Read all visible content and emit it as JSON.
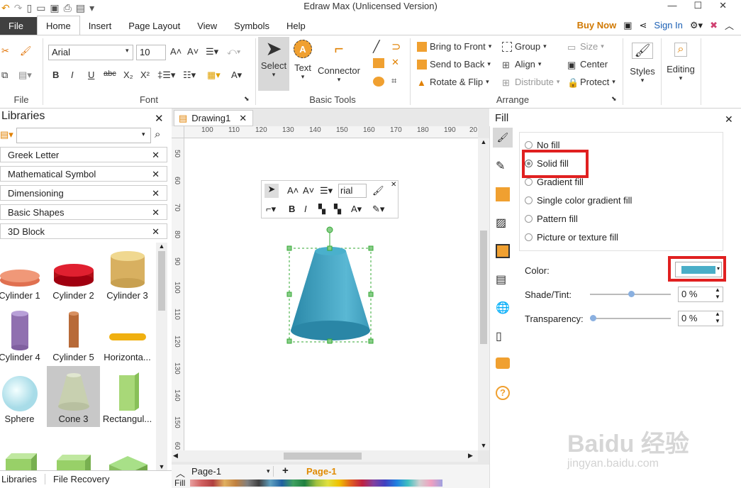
{
  "app": {
    "title": "Edraw Max (Unlicensed Version)"
  },
  "window": {
    "minimize": "—",
    "maximize": "☐",
    "close": "✕"
  },
  "menu": {
    "file": "File",
    "tabs": [
      "Home",
      "Insert",
      "Page Layout",
      "View",
      "Symbols",
      "Help"
    ],
    "buy_now": "Buy Now",
    "sign_in": "Sign In"
  },
  "ribbon": {
    "file_group": {
      "label": "File"
    },
    "font_group": {
      "label": "Font",
      "font_name": "Arial",
      "font_size": "10"
    },
    "basic_tools": {
      "label": "Basic Tools",
      "select": "Select",
      "text": "Text",
      "connector": "Connector"
    },
    "arrange": {
      "label": "Arrange",
      "bring_to_front": "Bring to Front",
      "send_to_back": "Send to Back",
      "rotate_flip": "Rotate & Flip",
      "group": "Group",
      "align": "Align",
      "distribute": "Distribute",
      "size": "Size",
      "center": "Center",
      "protect": "Protect"
    },
    "styles": "Styles",
    "editing": "Editing"
  },
  "libraries": {
    "title": "Libraries",
    "search_value": "",
    "categories": [
      "Greek Letter",
      "Mathematical Symbol",
      "Dimensioning",
      "Basic Shapes",
      "3D Block"
    ],
    "shapes": [
      "Cylinder 1",
      "Cylinder 2",
      "Cylinder 3",
      "Cylinder 4",
      "Cylinder 5",
      "Horizonta...",
      "Sphere",
      "Cone 3",
      "Rectangul..."
    ],
    "bottom_tabs": [
      "Libraries",
      "File Recovery"
    ]
  },
  "document": {
    "tab": "Drawing1",
    "ruler_h": [
      "100",
      "110",
      "120",
      "130",
      "140",
      "150",
      "160",
      "170",
      "180",
      "190",
      "20"
    ],
    "ruler_v": [
      "50",
      "60",
      "70",
      "80",
      "90",
      "100",
      "110",
      "120",
      "130",
      "140",
      "150",
      "160",
      "60"
    ],
    "page_tab": "Page-1",
    "active_page": "Page-1",
    "fill_label": "Fill",
    "mini_toolbar_font": "rial"
  },
  "fill_panel": {
    "title": "Fill",
    "options": [
      "No fill",
      "Solid fill",
      "Gradient fill",
      "Single color gradient fill",
      "Pattern fill",
      "Picture or texture fill"
    ],
    "selected": "Solid fill",
    "color_label": "Color:",
    "color_value": "#4aaec8",
    "shade_label": "Shade/Tint:",
    "shade_value": "0 %",
    "transparency_label": "Transparency:",
    "transparency_value": "0 %"
  },
  "watermark": {
    "logo": "Baidu 经验",
    "url": "jingyan.baidu.com"
  }
}
